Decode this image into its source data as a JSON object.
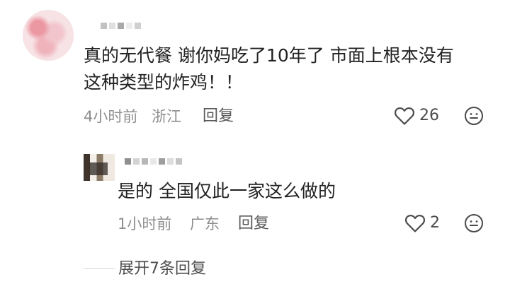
{
  "comment": {
    "text_line_1": "真的无代餐 谢你妈吃了10年了 市面上根本没有",
    "text_line_2": "这种类型的炸鸡！！",
    "time": "4小时前",
    "location": "浙江",
    "reply_label": "回复",
    "likes": "26"
  },
  "reply": {
    "text": "是的 全国仅此一家这么做的",
    "time": "1小时前",
    "location": "广东",
    "reply_label": "回复",
    "likes": "2"
  },
  "expand_replies_label": "展开7条回复",
  "colors": {
    "text": "#222222",
    "meta": "#8e8e8e",
    "icon": "#4a4a4a",
    "avatar_pink": "#f6dadd"
  },
  "icons": {
    "like": "heart-outline-icon",
    "emoji": "smiley-face-icon"
  }
}
